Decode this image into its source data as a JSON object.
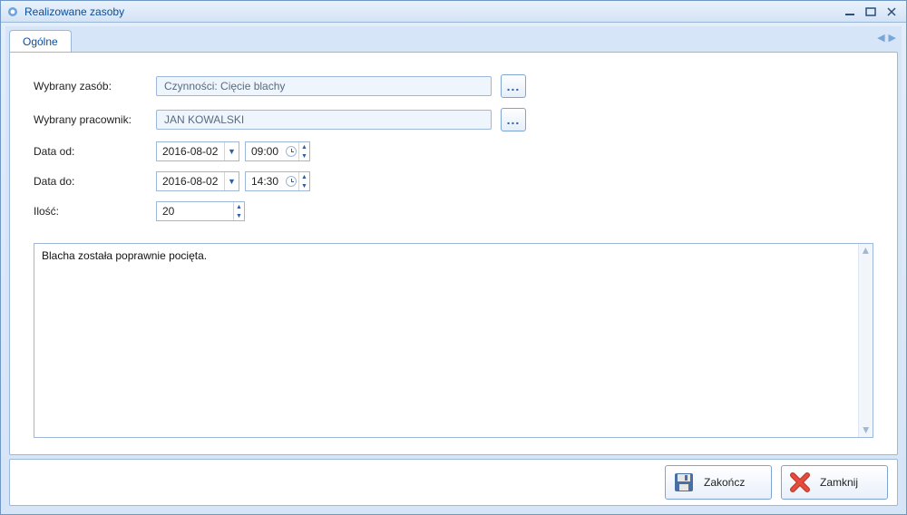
{
  "window": {
    "title": "Realizowane zasoby"
  },
  "tabs": {
    "general": "Ogólne"
  },
  "form": {
    "resource_label": "Wybrany zasób:",
    "resource_value": "Czynności: Cięcie blachy",
    "employee_label": "Wybrany pracownik:",
    "employee_value": "JAN KOWALSKI",
    "date_from_label": "Data od:",
    "date_from_value": "2016-08-02",
    "time_from_value": "09:00",
    "date_to_label": "Data do:",
    "date_to_value": "2016-08-02",
    "time_to_value": "14:30",
    "qty_label": "Ilość:",
    "qty_value": "20",
    "notes": "Blacha została poprawnie pocięta.",
    "ellipsis": "..."
  },
  "footer": {
    "finish": "Zakończ",
    "close": "Zamknij"
  }
}
